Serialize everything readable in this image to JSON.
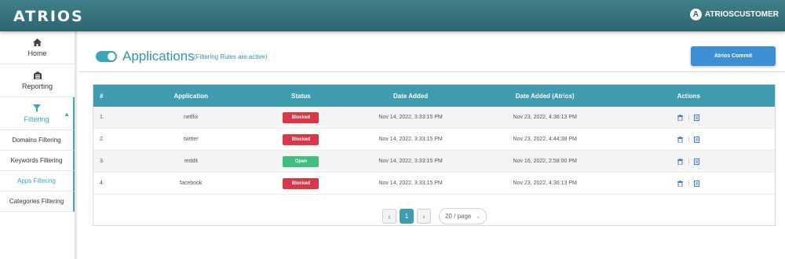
{
  "topbar": {
    "logo": "ATRIOS",
    "user_initial": "A",
    "user_name": "ATRIOSCUSTOMER"
  },
  "sidebar": {
    "items": [
      {
        "label": "Home",
        "icon": "home-icon"
      },
      {
        "label": "Reporting",
        "icon": "reporting-icon"
      },
      {
        "label": "Filtering",
        "icon": "filter-icon"
      }
    ],
    "subitems": [
      "Domains Filtering",
      "Keywords Filtering",
      "Apps Filtering",
      "Categories Filtering"
    ]
  },
  "header": {
    "title": "Applications",
    "subtitle": "(Filtering Rules are active)",
    "commit_label": "Atrios Commit",
    "toggle_on": true
  },
  "table": {
    "columns": [
      "#",
      "Application",
      "Status",
      "Date Added",
      "Date Added (Atrios)",
      "Actions"
    ],
    "rows": [
      {
        "num": "1.",
        "app": "netflix",
        "status": "Blocked",
        "date": "Nov 14, 2022, 3:33:15 PM",
        "date_atrios": "Nov 23, 2022, 4:36:13 PM"
      },
      {
        "num": "2.",
        "app": "twitter",
        "status": "Blocked",
        "date": "Nov 14, 2022, 3:33:15 PM",
        "date_atrios": "Nov 23, 2022, 4:44:38 PM"
      },
      {
        "num": "3.",
        "app": "reddit",
        "status": "Open",
        "date": "Nov 14, 2022, 3:33:15 PM",
        "date_atrios": "Nov 16, 2022, 2:58:00 PM"
      },
      {
        "num": "4.",
        "app": "facebook",
        "status": "Blocked",
        "date": "Nov 14, 2022, 3:33:15 PM",
        "date_atrios": "Nov 23, 2022, 4:36:13 PM"
      }
    ]
  },
  "pagination": {
    "prev": "‹",
    "current": "1",
    "next": "›",
    "page_size": "20 / page"
  },
  "colors": {
    "accent": "#3aa6b9",
    "blocked": "#dc3545",
    "open": "#3fbf7f",
    "commit": "#3d8fd3"
  }
}
